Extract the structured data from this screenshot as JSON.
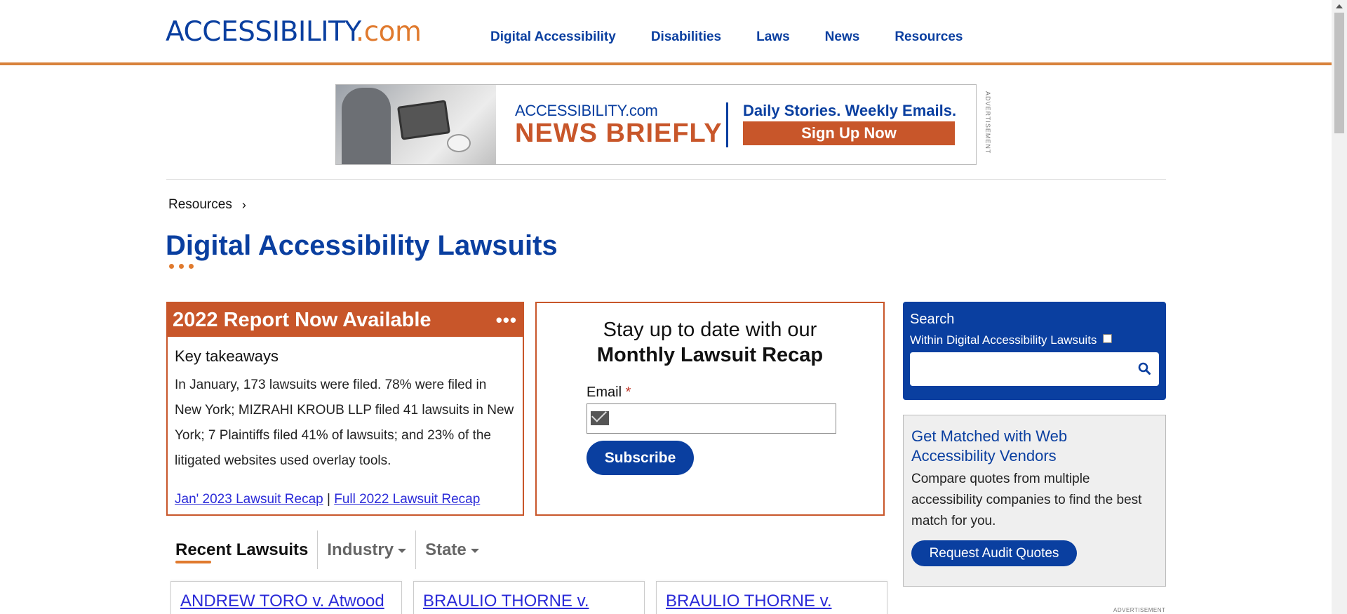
{
  "header": {
    "logo_main": "ACCESSIBILITY",
    "logo_suffix": ".com",
    "nav": [
      "Digital Accessibility",
      "Disabilities",
      "Laws",
      "News",
      "Resources"
    ]
  },
  "ad_banner": {
    "brand": "ACCESSIBILITY.com",
    "headline": "NEWS BRIEFLY",
    "tagline": "Daily Stories. Weekly Emails.",
    "cta": "Sign Up Now",
    "label": "ADVERTISEMENT"
  },
  "breadcrumb": {
    "label": "Resources"
  },
  "page": {
    "title": "Digital Accessibility Lawsuits"
  },
  "report": {
    "heading": "2022 Report Now Available",
    "more": "•••",
    "subheading": "Key takeaways",
    "body": "In January, 173 lawsuits were filed. 78% were filed in New York; MIZRAHI KROUB LLP filed 41 lawsuits in New York; 7 Plaintiffs filed 41% of lawsuits; and 23% of the litigated websites used overlay tools.",
    "link1": "Jan' 2023 Lawsuit Recap",
    "separator": " | ",
    "link2": "Full 2022 Lawsuit Recap"
  },
  "newsletter": {
    "line1": "Stay up to date with our",
    "line2": "Monthly Lawsuit Recap",
    "email_label": "Email",
    "required": "*",
    "email_value": "",
    "subscribe": "Subscribe"
  },
  "search": {
    "title": "Search",
    "scope": "Within Digital Accessibility Lawsuits",
    "scope_checked": false,
    "query": ""
  },
  "vendors": {
    "title": "Get Matched with Web Accessibility Vendors",
    "text": "Compare quotes from multiple accessibility companies to find the best match for you.",
    "button": "Request Audit Quotes",
    "ad_label": "ADVERTISEMENT"
  },
  "tabs": [
    {
      "label": "Recent Lawsuits",
      "active": true
    },
    {
      "label": "Industry",
      "dropdown": true
    },
    {
      "label": "State",
      "dropdown": true
    }
  ],
  "lawsuits": [
    {
      "title": "ANDREW TORO v. Atwood"
    },
    {
      "title": "BRAULIO THORNE v."
    },
    {
      "title": "BRAULIO THORNE v."
    }
  ],
  "colors": {
    "brand_blue": "#0a3fa0",
    "accent_orange": "#e07a2e",
    "report_red": "#c8562a"
  }
}
